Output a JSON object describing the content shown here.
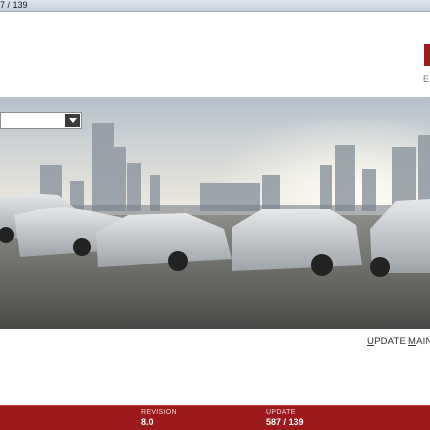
{
  "window": {
    "title": "7 / 139"
  },
  "brand": {
    "subtitle": "E",
    "accent_color": "#9b1b1e"
  },
  "model_select": {
    "value": ""
  },
  "nav": {
    "update_first": "U",
    "update_rest": "PDATE",
    "maint_first": "M",
    "maint_rest": "AINT"
  },
  "footer": {
    "background_color": "#9c1a1c",
    "revision_label": "REVISION",
    "revision_value": "8.0",
    "update_label": "UPDATE",
    "update_value": "587 / 139"
  }
}
